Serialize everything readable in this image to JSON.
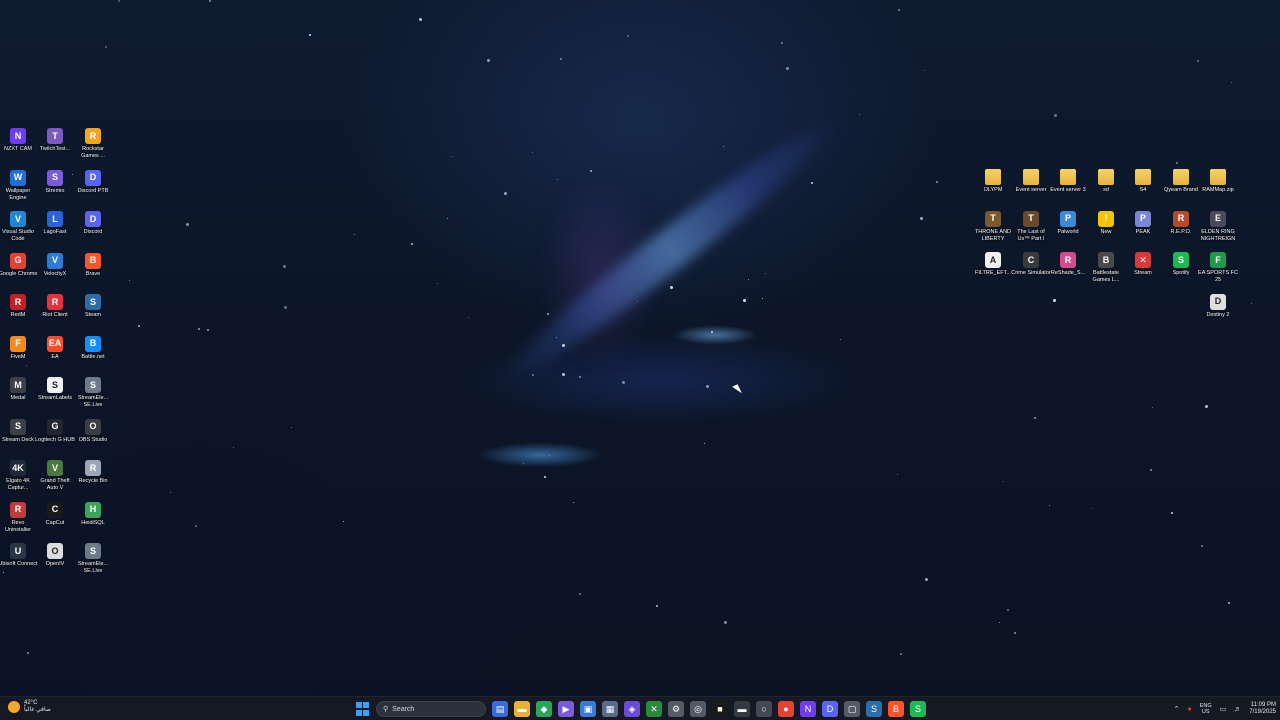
{
  "desktop_left_icons": [
    {
      "label": "NZXT CAM",
      "icon": "nzxt-cam-icon",
      "color": "#6f3df0",
      "glyph": "N"
    },
    {
      "label": "TwitchTest...",
      "icon": "twitch-test-icon",
      "color": "#7d5bbe",
      "glyph": "T"
    },
    {
      "label": "Rockstar Games ...",
      "icon": "rockstar-games-icon",
      "color": "#f0a623",
      "glyph": "R"
    },
    {
      "label": "Wallpaper Engine",
      "icon": "wallpaper-engine-icon",
      "color": "#1f6fd6",
      "glyph": "W"
    },
    {
      "label": "Stremio",
      "icon": "stremio-icon",
      "color": "#7b5bd9",
      "glyph": "S"
    },
    {
      "label": "Discord PTB",
      "icon": "discord-ptb-icon",
      "color": "#5865f2",
      "glyph": "D"
    },
    {
      "label": "Visual Studio Code",
      "icon": "vscode-icon",
      "color": "#1e88d6",
      "glyph": "V"
    },
    {
      "label": "LagoFast",
      "icon": "lagofast-icon",
      "color": "#2a62d8",
      "glyph": "L"
    },
    {
      "label": "Discord",
      "icon": "discord-icon",
      "color": "#5865f2",
      "glyph": "D"
    },
    {
      "label": "Google Chrome",
      "icon": "chrome-icon",
      "color": "#e34133",
      "glyph": "G"
    },
    {
      "label": "VelocityX",
      "icon": "velocityx-icon",
      "color": "#2e7bd6",
      "glyph": "V"
    },
    {
      "label": "Brave",
      "icon": "brave-icon",
      "color": "#fb542b",
      "glyph": "B"
    },
    {
      "label": "RedM",
      "icon": "redm-icon",
      "color": "#c21f26",
      "glyph": "R"
    },
    {
      "label": "Riot Client",
      "icon": "riot-client-icon",
      "color": "#e3333b",
      "glyph": "R"
    },
    {
      "label": "Steam",
      "icon": "steam-icon",
      "color": "#2a6da8",
      "glyph": "S"
    },
    {
      "label": "FiveM",
      "icon": "fivem-icon",
      "color": "#f28a22",
      "glyph": "F"
    },
    {
      "label": "EA",
      "icon": "ea-icon",
      "color": "#ff4b2b",
      "glyph": "EA"
    },
    {
      "label": "Battle.net",
      "icon": "battlenet-icon",
      "color": "#148eff",
      "glyph": "B"
    },
    {
      "label": "Medal",
      "icon": "medal-icon",
      "color": "#3a3f4b",
      "glyph": "M"
    },
    {
      "label": "StreamLabels",
      "icon": "streamlabels-icon",
      "color": "#f2f2f2",
      "glyph": "S"
    },
    {
      "label": "StreamEle... SE.Live",
      "icon": "streamelements-icon",
      "color": "#6c7a8a",
      "glyph": "S"
    },
    {
      "label": "Stream Deck",
      "icon": "stream-deck-icon",
      "color": "#3b3f48",
      "glyph": "S"
    },
    {
      "label": "Logitech G HUB",
      "icon": "logitech-ghub-icon",
      "color": "#22262e",
      "glyph": "G"
    },
    {
      "label": "OBS Studio",
      "icon": "obs-studio-icon",
      "color": "#3a3d44",
      "glyph": "O"
    },
    {
      "label": "Elgato 4K Captur...",
      "icon": "elgato-capture-icon",
      "color": "#1e2a3a",
      "glyph": "4K"
    },
    {
      "label": "Grand Theft Auto V",
      "icon": "gta-v-icon",
      "color": "#4a7a3a",
      "glyph": "V"
    },
    {
      "label": "Recycle Bin",
      "icon": "recycle-bin-icon",
      "color": "#9aa7b6",
      "glyph": "R"
    },
    {
      "label": "Revo Uninstaller",
      "icon": "revo-uninstaller-icon",
      "color": "#c23a3a",
      "glyph": "R"
    },
    {
      "label": "CapCut",
      "icon": "capcut-icon",
      "color": "#1a1a1a",
      "glyph": "C"
    },
    {
      "label": "HeidiSQL",
      "icon": "heidisql-icon",
      "color": "#3aa55a",
      "glyph": "H"
    },
    {
      "label": "Ubisoft Connect",
      "icon": "ubisoft-connect-icon",
      "color": "#2a3545",
      "glyph": "U"
    },
    {
      "label": "OpenIV",
      "icon": "openiv-icon",
      "color": "#dcdcdc",
      "glyph": "O"
    },
    {
      "label": "StreamEle... SE.Live",
      "icon": "streamelements-icon",
      "color": "#6c7a8a",
      "glyph": "S"
    }
  ],
  "desktop_right_icons": [
    {
      "label": "OLYPM",
      "icon": "folder-icon",
      "color": "#e6b23a",
      "glyph": ""
    },
    {
      "label": "Event server",
      "icon": "folder-icon",
      "color": "#e6b23a",
      "glyph": ""
    },
    {
      "label": "Event server 3",
      "icon": "folder-icon",
      "color": "#e6b23a",
      "glyph": ""
    },
    {
      "label": "sd",
      "icon": "folder-icon",
      "color": "#e6b23a",
      "glyph": ""
    },
    {
      "label": "S4",
      "icon": "folder-icon",
      "color": "#e6b23a",
      "glyph": ""
    },
    {
      "label": "Qyeam Brand",
      "icon": "folder-icon",
      "color": "#e6b23a",
      "glyph": ""
    },
    {
      "label": "RAMMap.zip",
      "icon": "zip-folder-icon",
      "color": "#e6b23a",
      "glyph": ""
    },
    {
      "label": "THRONE AND LIBERTY",
      "icon": "throne-and-liberty-icon",
      "color": "#7a5a2a",
      "glyph": "T"
    },
    {
      "label": "The Last of Us™ Part I",
      "icon": "last-of-us-icon",
      "color": "#6a4a2a",
      "glyph": "T"
    },
    {
      "label": "Palworld",
      "icon": "palworld-icon",
      "color": "#3a8ad8",
      "glyph": "P"
    },
    {
      "label": "New",
      "icon": "warning-icon",
      "color": "#f5c400",
      "glyph": "!"
    },
    {
      "label": "PEAK",
      "icon": "peak-icon",
      "color": "#7a86d6",
      "glyph": "P"
    },
    {
      "label": "R.E.P.O.",
      "icon": "repo-icon",
      "color": "#b34a2a",
      "glyph": "R"
    },
    {
      "label": "ELDEN RING NIGHTREIGN",
      "icon": "elden-ring-icon",
      "color": "#4a4a5a",
      "glyph": "E"
    },
    {
      "label": "FILTRE_EFT...",
      "icon": "file-icon",
      "color": "#f2f2f2",
      "glyph": "A"
    },
    {
      "label": "Crime Simulator",
      "icon": "crime-simulator-icon",
      "color": "#3a3a3a",
      "glyph": "C"
    },
    {
      "label": "ReShade_S...",
      "icon": "reshade-icon",
      "color": "#d44a8a",
      "glyph": "R"
    },
    {
      "label": "Battlestate Games L...",
      "icon": "battlestate-icon",
      "color": "#4a4a4a",
      "glyph": "B"
    },
    {
      "label": "Stream",
      "icon": "close-x-icon",
      "color": "#d83a3a",
      "glyph": "✕"
    },
    {
      "label": "Spotify",
      "icon": "spotify-icon",
      "color": "#1db954",
      "glyph": "S"
    },
    {
      "label": "EA SPORTS FC 25",
      "icon": "ea-sports-fc-icon",
      "color": "#1e9a4a",
      "glyph": "F"
    },
    {
      "label": "Destiny 2",
      "icon": "destiny-2-icon",
      "color": "#e0e0e0",
      "glyph": "D"
    }
  ],
  "taskbar": {
    "weather_temp": "42°C",
    "weather_desc": "صافي غالباً",
    "search_label": "Search",
    "apps": [
      {
        "icon": "task-view-icon",
        "color": "#3a6ad8",
        "glyph": "▤"
      },
      {
        "icon": "file-explorer-icon",
        "color": "#e6b23a",
        "glyph": "▬"
      },
      {
        "icon": "app-green-icon",
        "color": "#2aa55a",
        "glyph": "◆"
      },
      {
        "icon": "app-purple-icon",
        "color": "#7a5bd9",
        "glyph": "▶"
      },
      {
        "icon": "app-blue-icon",
        "color": "#3a7ad8",
        "glyph": "▣"
      },
      {
        "icon": "store-icon",
        "color": "#5a6a8a",
        "glyph": "▦"
      },
      {
        "icon": "app-violet-icon",
        "color": "#6a4ad8",
        "glyph": "◈"
      },
      {
        "icon": "xbox-icon",
        "color": "#2a8a3a",
        "glyph": "✕"
      },
      {
        "icon": "settings-icon",
        "color": "#555a66",
        "glyph": "⚙"
      },
      {
        "icon": "app-gray-icon",
        "color": "#555a66",
        "glyph": "◎"
      },
      {
        "icon": "capcut-icon",
        "color": "#1a1a1a",
        "glyph": "■"
      },
      {
        "icon": "app-dark-icon",
        "color": "#333a44",
        "glyph": "▬"
      },
      {
        "icon": "app-gray2-icon",
        "color": "#444a55",
        "glyph": "○"
      },
      {
        "icon": "chrome-icon",
        "color": "#e34133",
        "glyph": "●"
      },
      {
        "icon": "nzxt-icon",
        "color": "#6f3df0",
        "glyph": "N"
      },
      {
        "icon": "discord-icon",
        "color": "#5865f2",
        "glyph": "D"
      },
      {
        "icon": "app-gray3-icon",
        "color": "#555a66",
        "glyph": "▢"
      },
      {
        "icon": "steam-icon",
        "color": "#2a6da8",
        "glyph": "S"
      },
      {
        "icon": "brave-icon",
        "color": "#fb542b",
        "glyph": "B"
      },
      {
        "icon": "spotify-icon",
        "color": "#1db954",
        "glyph": "S"
      }
    ],
    "lang_top": "ENG",
    "lang_bottom": "US",
    "time": "11:09 PM",
    "date": "7/19/2025"
  }
}
